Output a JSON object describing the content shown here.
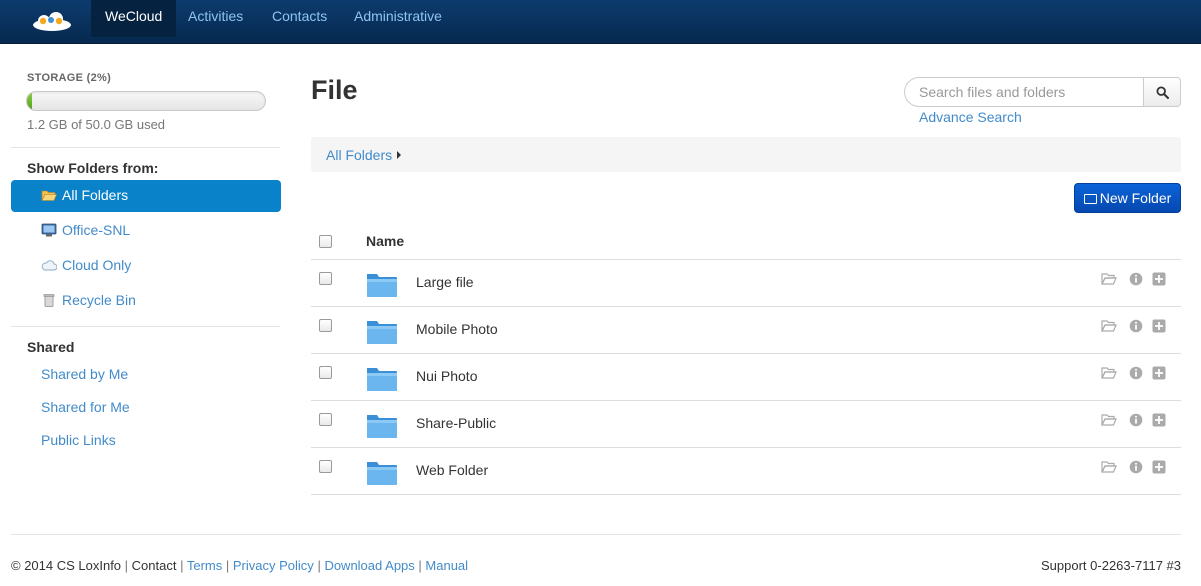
{
  "nav": {
    "items": [
      {
        "label": "WeCloud",
        "active": true
      },
      {
        "label": "Activities",
        "active": false
      },
      {
        "label": "Contacts",
        "active": false
      },
      {
        "label": "Administrative",
        "active": false
      }
    ]
  },
  "sidebar": {
    "storage_title": "STORAGE (2%)",
    "storage_percent": 2,
    "storage_used": "1.2 GB of 50.0 GB used",
    "folders_heading": "Show Folders from:",
    "folders": [
      {
        "label": "All Folders",
        "icon": "folder-open-icon",
        "active": true
      },
      {
        "label": "Office-SNL",
        "icon": "monitor-icon",
        "active": false
      },
      {
        "label": "Cloud Only",
        "icon": "cloud-icon",
        "active": false
      },
      {
        "label": "Recycle Bin",
        "icon": "trash-icon",
        "active": false
      }
    ],
    "shared_heading": "Shared",
    "shared_links": [
      "Shared by Me",
      "Shared for Me",
      "Public Links"
    ]
  },
  "main": {
    "title": "File",
    "search_placeholder": "Search files and folders",
    "advance_search": "Advance Search",
    "breadcrumb": "All Folders",
    "new_folder": "New Folder",
    "column_name": "Name",
    "rows": [
      "Large file",
      "Mobile Photo",
      "Nui Photo",
      "Share-Public",
      "Web Folder"
    ]
  },
  "footer": {
    "copyright": "© 2014 CS LoxInfo",
    "contact": "Contact",
    "links": [
      "Terms",
      "Privacy Policy",
      "Download Apps",
      "Manual"
    ],
    "support": "Support 0-2263-7117 #3"
  },
  "colors": {
    "accent": "#0a82c9",
    "link": "#428bca",
    "navbar": "#0d3b6e",
    "button": "#0b63d8"
  }
}
